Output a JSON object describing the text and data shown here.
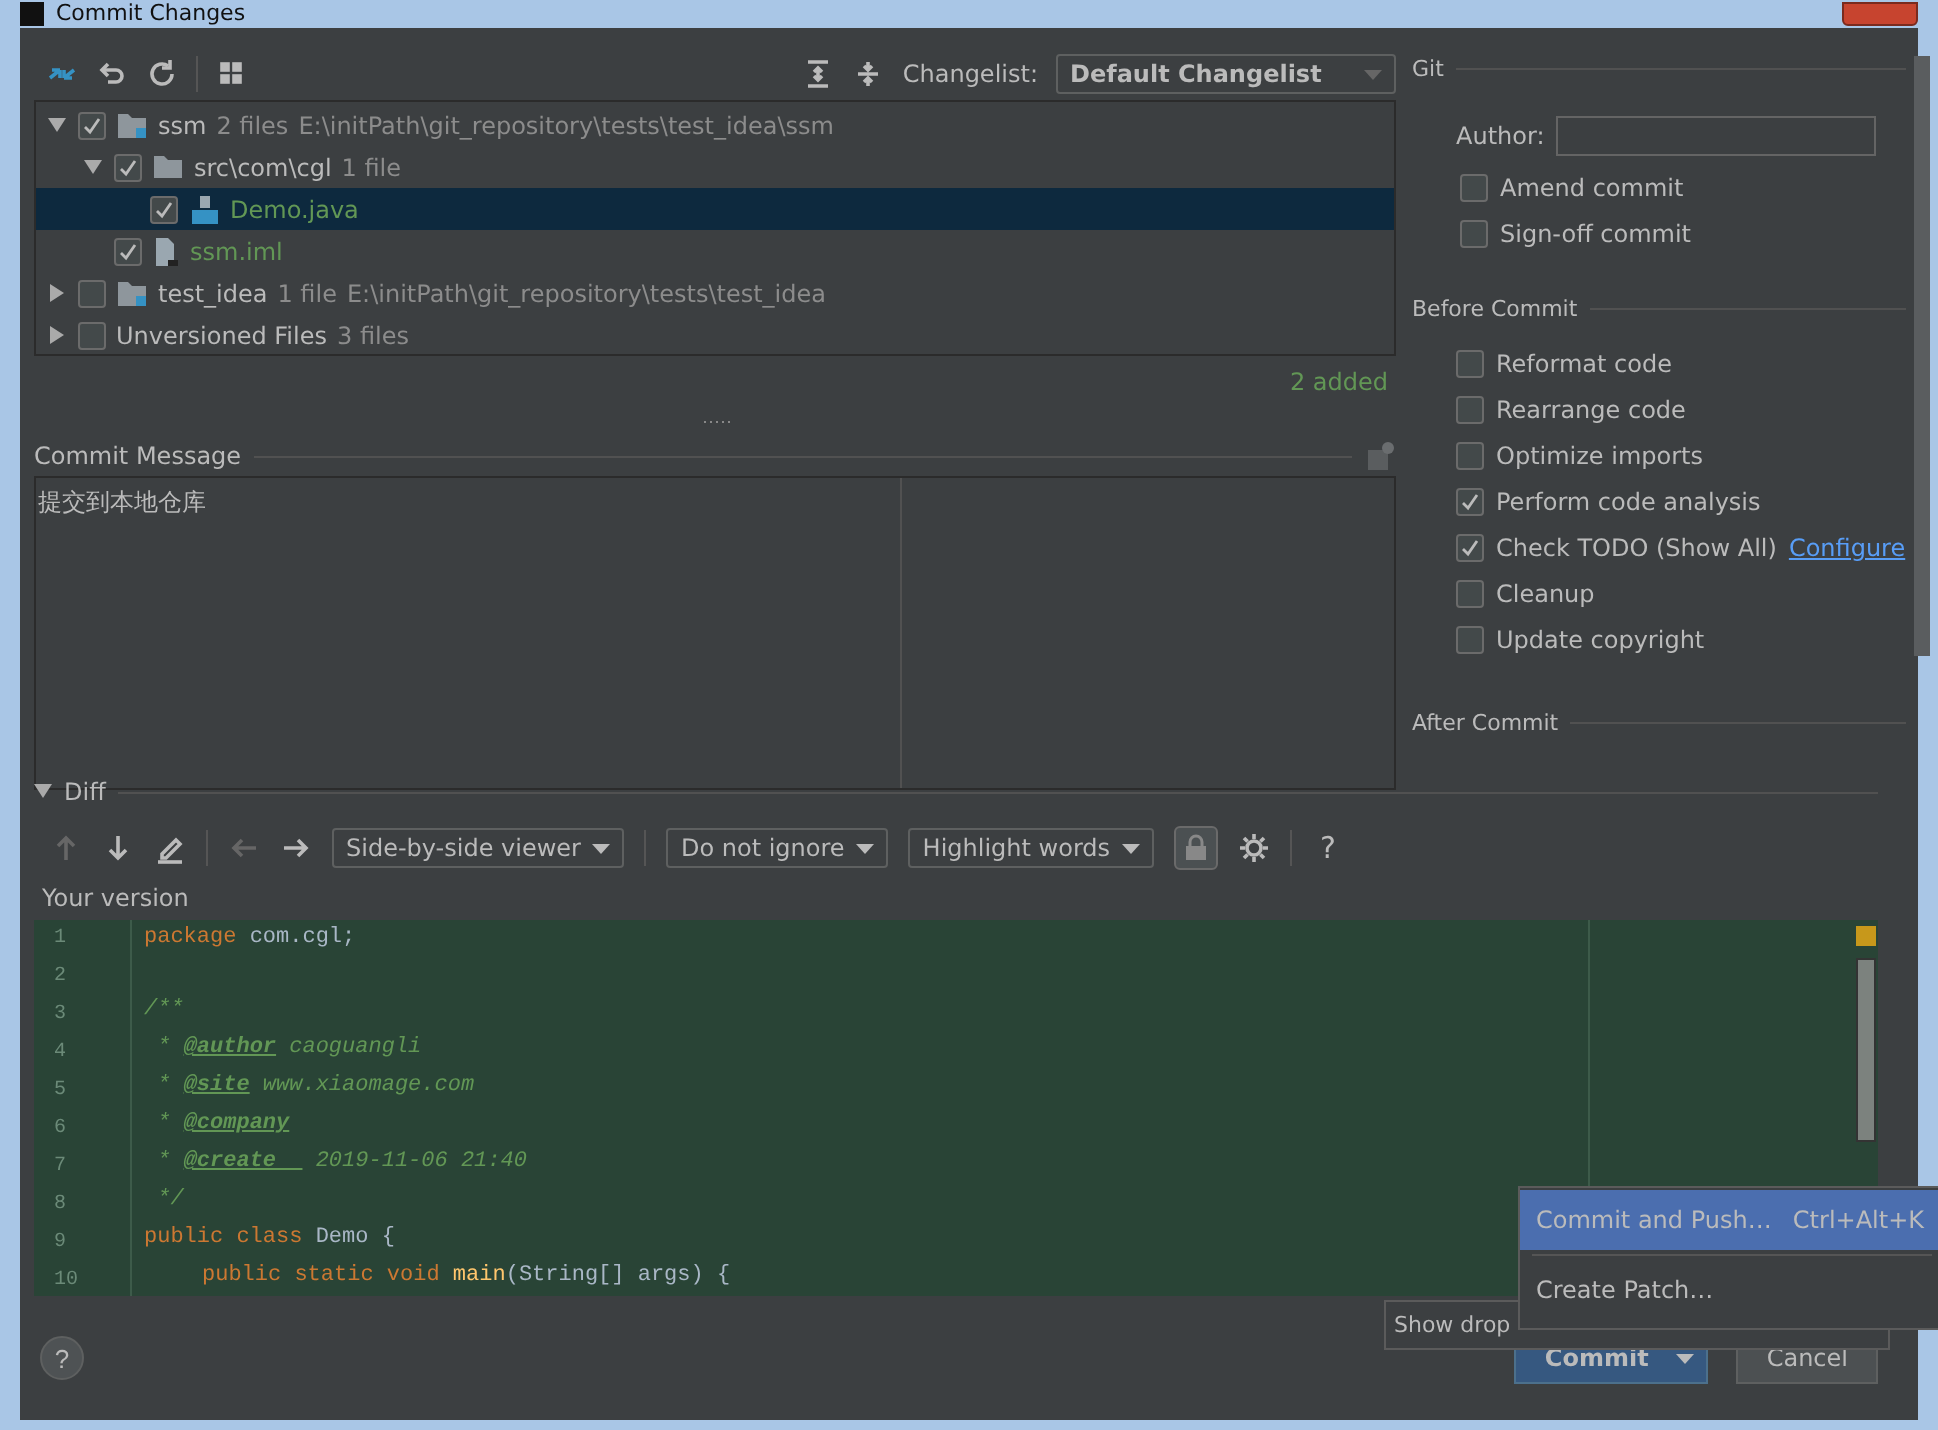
{
  "window": {
    "title": "Commit Changes"
  },
  "changes_toolbar": {
    "changelist_label": "Changelist:",
    "changelist": "Default Changelist"
  },
  "tree": [
    {
      "name": "ssm",
      "count": "2 files",
      "path": "E:\\initPath\\git_repository\\tests\\test_idea\\ssm",
      "kind": "module",
      "color": "#bbbbbb",
      "checked": true,
      "expanded": true,
      "selected": false,
      "children": [
        {
          "name": "src\\com\\cgl",
          "count": "1 file",
          "kind": "folder",
          "color": "#bbbbbb",
          "checked": true,
          "expanded": true,
          "selected": false,
          "children": [
            {
              "name": "Demo.java",
              "kind": "java",
              "color": "#629755",
              "checked": true,
              "selected": true
            }
          ]
        },
        {
          "name": "ssm.iml",
          "kind": "iml",
          "color": "#629755",
          "checked": true,
          "selected": false
        }
      ]
    },
    {
      "name": "test_idea",
      "count": "1 file",
      "path": "E:\\initPath\\git_repository\\tests\\test_idea",
      "kind": "module",
      "color": "#bbbbbb",
      "checked": false,
      "expanded": false,
      "selected": false
    },
    {
      "name": "Unversioned Files",
      "count": "3 files",
      "kind": "group",
      "color": "#bbbbbb",
      "checked": false,
      "expanded": false,
      "selected": false
    }
  ],
  "summary": "2 added",
  "commit_message": {
    "label": "Commit Message",
    "value": "提交到本地仓库"
  },
  "git": {
    "title": "Git",
    "author_label": "Author:",
    "options": [
      {
        "label": "Amend commit",
        "checked": false
      },
      {
        "label": "Sign-off commit",
        "checked": false
      }
    ]
  },
  "before_commit": {
    "title": "Before Commit",
    "options": [
      {
        "label": "Reformat code",
        "checked": false
      },
      {
        "label": "Rearrange code",
        "checked": false
      },
      {
        "label": "Optimize imports",
        "checked": false
      },
      {
        "label": "Perform code analysis",
        "checked": true
      },
      {
        "label": "Check TODO (Show All)",
        "checked": true,
        "link": "Configure"
      },
      {
        "label": "Cleanup",
        "checked": false
      },
      {
        "label": "Update copyright",
        "checked": false
      }
    ]
  },
  "after_commit": {
    "title": "After Commit"
  },
  "diff": {
    "title": "Diff",
    "expanded": true,
    "viewer": "Side-by-side viewer",
    "ignore": "Do not ignore",
    "highlight": "Highlight words",
    "help": "?",
    "version_label": "Your version",
    "lines": [
      {
        "number": "1",
        "segments": [
          {
            "kind": "keyword",
            "text": "package"
          },
          {
            "kind": "plain",
            "text": " com.cgl;"
          }
        ]
      },
      {
        "number": "2"
      },
      {
        "number": "3",
        "segments": [
          {
            "kind": "comment",
            "text": "/**"
          }
        ]
      },
      {
        "number": "4",
        "segments": [
          {
            "kind": "comment",
            "text": " * "
          },
          {
            "kind": "tag",
            "text": "@author"
          },
          {
            "kind": "comment",
            "text": " caoguangli"
          }
        ]
      },
      {
        "number": "5",
        "segments": [
          {
            "kind": "comment",
            "text": " * "
          },
          {
            "kind": "tag",
            "text": "@site"
          },
          {
            "kind": "comment",
            "text": " www.xiaomage.com"
          }
        ]
      },
      {
        "number": "6",
        "segments": [
          {
            "kind": "comment",
            "text": " * "
          },
          {
            "kind": "tag",
            "text": "@company"
          }
        ]
      },
      {
        "number": "7",
        "segments": [
          {
            "kind": "comment",
            "text": " * "
          },
          {
            "kind": "tag",
            "text": "@create  "
          },
          {
            "kind": "comment",
            "text": " 2019-11-06 21:40"
          }
        ]
      },
      {
        "number": "8",
        "segments": [
          {
            "kind": "comment",
            "text": " */"
          }
        ]
      },
      {
        "number": "9",
        "segments": [
          {
            "kind": "keyword",
            "text": "public class"
          },
          {
            "kind": "plain",
            "text": " Demo {"
          }
        ]
      },
      {
        "number": "10",
        "indented": true,
        "segments": [
          {
            "kind": "keyword",
            "text": "public static void"
          },
          {
            "kind": "method",
            "text": " main"
          },
          {
            "kind": "plain",
            "text": "(String[] args) {"
          }
        ]
      }
    ]
  },
  "footer": {
    "help": "?",
    "commit": "Commit",
    "cancel": "Cancel",
    "tooltip": "Show drop",
    "menu": [
      {
        "label": "Commit and Push…",
        "shortcut": "Ctrl+Alt+K",
        "selected": true
      },
      {
        "label": "Create Patch…",
        "selected": false
      }
    ]
  }
}
